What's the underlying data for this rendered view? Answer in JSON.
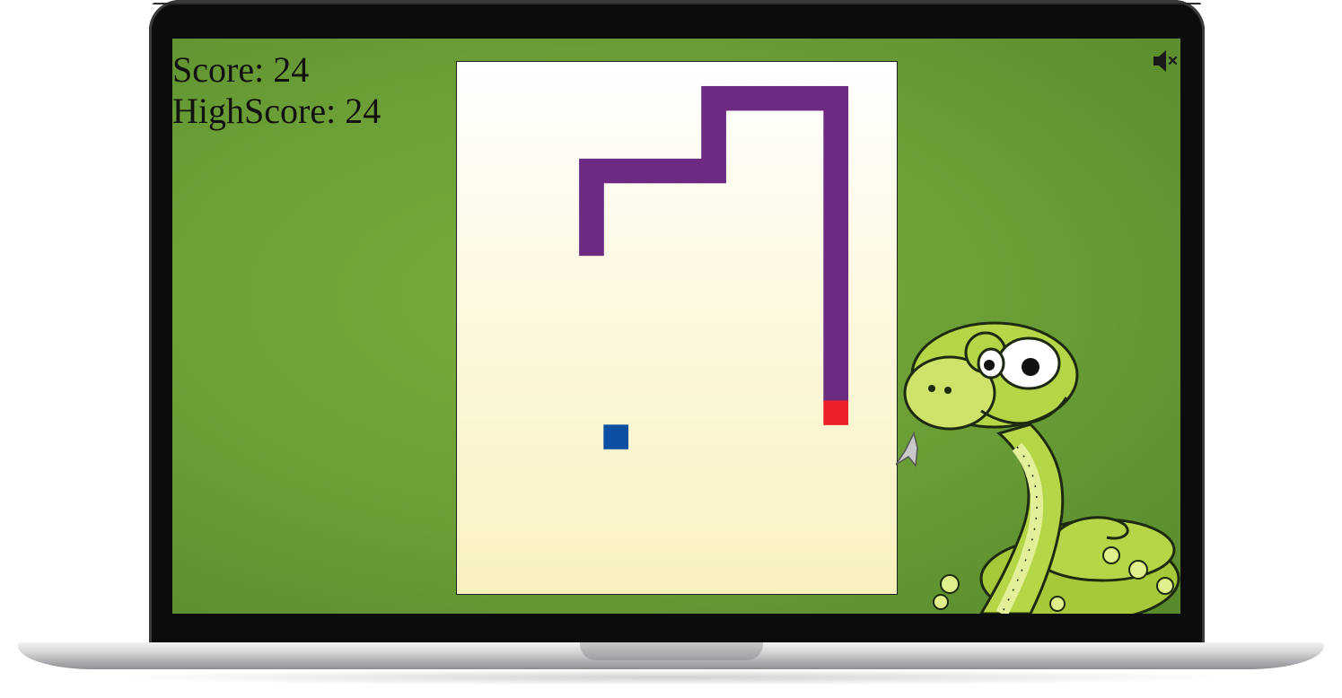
{
  "game": {
    "score_text": "Score: 24",
    "highscore_text": "HighScore: 24",
    "score": 24,
    "highscore": 24
  },
  "controls": {
    "mute_icon": "speaker-muted-icon",
    "muted": true
  },
  "board": {
    "grid_cols": 18,
    "grid_rows": 22,
    "snake_color": "#6c2a80",
    "head_color": "#ec2028",
    "food_color": "#0c4ea2",
    "snake_cells": [
      [
        5,
        7
      ],
      [
        5,
        6
      ],
      [
        5,
        5
      ],
      [
        5,
        4
      ],
      [
        6,
        4
      ],
      [
        7,
        4
      ],
      [
        8,
        4
      ],
      [
        9,
        4
      ],
      [
        10,
        4
      ],
      [
        10,
        3
      ],
      [
        10,
        2
      ],
      [
        10,
        1
      ],
      [
        11,
        1
      ],
      [
        12,
        1
      ],
      [
        13,
        1
      ],
      [
        14,
        1
      ],
      [
        15,
        1
      ],
      [
        15,
        2
      ],
      [
        15,
        3
      ],
      [
        15,
        4
      ],
      [
        15,
        5
      ],
      [
        15,
        6
      ],
      [
        15,
        7
      ],
      [
        15,
        8
      ],
      [
        15,
        9
      ],
      [
        15,
        10
      ],
      [
        15,
        11
      ],
      [
        15,
        12
      ],
      [
        15,
        13
      ]
    ],
    "head_cell": [
      15,
      14
    ],
    "food_cell": [
      6,
      15
    ]
  },
  "colors": {
    "background_green": "#6a9d35",
    "board_top": "#ffffff",
    "board_bottom": "#f8f2bf"
  }
}
